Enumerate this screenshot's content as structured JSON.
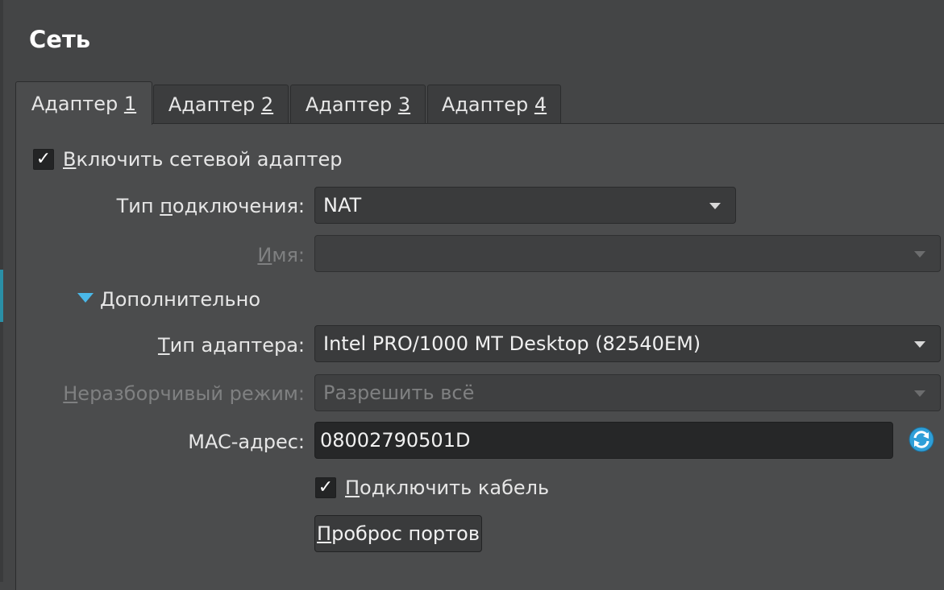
{
  "page": {
    "title": "Сеть"
  },
  "tabs": [
    {
      "prefix": "Адаптер ",
      "mnemonic": "1",
      "active": true
    },
    {
      "prefix": "Адаптер ",
      "mnemonic": "2",
      "active": false
    },
    {
      "prefix": "Адаптер ",
      "mnemonic": "3",
      "active": false
    },
    {
      "prefix": "Адаптер ",
      "mnemonic": "4",
      "active": false
    }
  ],
  "enable_adapter": {
    "checked": true,
    "mnemonic": "В",
    "rest": "ключить сетевой адаптер"
  },
  "attached_to": {
    "label_prefix": "Тип ",
    "label_mnemonic": "п",
    "label_rest": "одключения:",
    "value": "NAT"
  },
  "name": {
    "label_mnemonic": "И",
    "label_rest": "мя:",
    "value": "",
    "enabled": false
  },
  "advanced": {
    "label": "Дополнительно",
    "expanded": true
  },
  "adapter_type": {
    "label_mnemonic": "Т",
    "label_rest": "ип адаптера:",
    "value": "Intel PRO/1000 MT Desktop (82540EM)"
  },
  "promiscuous": {
    "label_mnemonic": "Н",
    "label_rest": "еразборчивый режим:",
    "value": "Разрешить всё",
    "enabled": false
  },
  "mac": {
    "label": "MAC-адрес:",
    "value": "08002790501D"
  },
  "cable": {
    "checked": true,
    "mnemonic": "П",
    "rest": "одключить кабель"
  },
  "port_forwarding": {
    "mnemonic": "П",
    "rest": "роброс портов"
  },
  "colors": {
    "accent": "#4ab8e8",
    "background": "#444546",
    "panel": "#4b4c4d"
  }
}
